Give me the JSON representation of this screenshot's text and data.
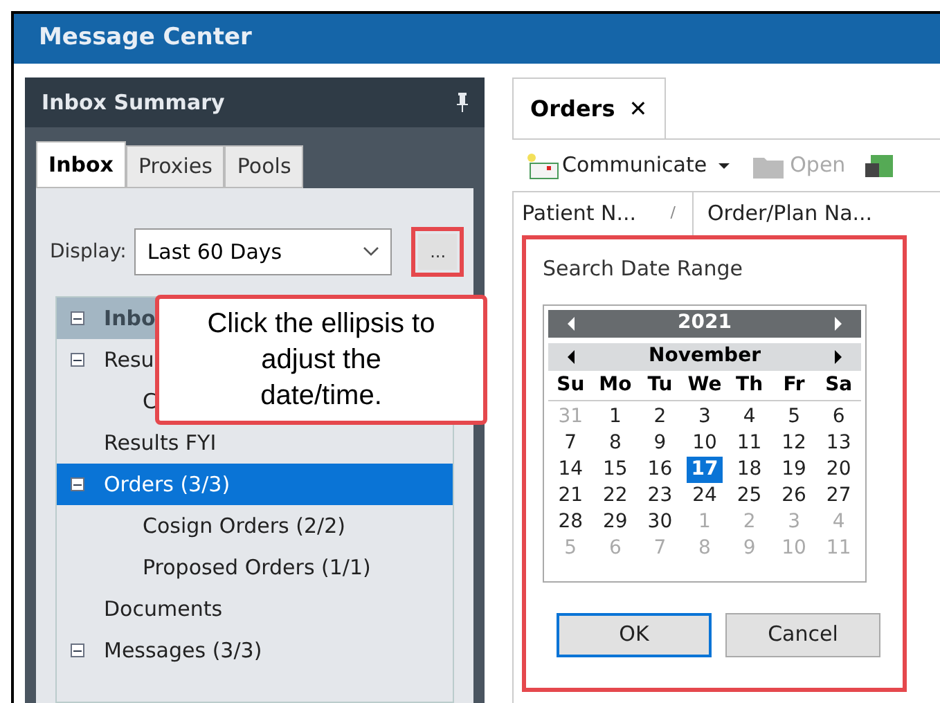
{
  "window": {
    "title": "Message Center"
  },
  "inbox_summary": {
    "title": "Inbox Summary",
    "tabs": [
      {
        "label": "Inbox",
        "selected": true
      },
      {
        "label": "Proxies",
        "selected": false
      },
      {
        "label": "Pools",
        "selected": false
      }
    ],
    "display": {
      "label": "Display:",
      "value": "Last 60 Days",
      "ellipsis": "..."
    },
    "tree": [
      {
        "label": "Inbo",
        "header": true,
        "expanded": true,
        "selected": false,
        "children": [
          {
            "label": "Resu",
            "expanded": true,
            "selected": false,
            "children": [
              {
                "label": "C",
                "selected": false
              }
            ]
          },
          {
            "label": "Results FYI",
            "selected": false
          },
          {
            "label": "Orders (3/3)",
            "expanded": true,
            "selected": true,
            "children": [
              {
                "label": "Cosign Orders (2/2)",
                "selected": false
              },
              {
                "label": "Proposed Orders (1/1)",
                "selected": false
              }
            ]
          },
          {
            "label": "Documents",
            "selected": false
          },
          {
            "label": "Messages (3/3)",
            "expanded": true,
            "selected": false
          }
        ]
      }
    ]
  },
  "callout": {
    "text": "Click the ellipsis to adjust the date/time."
  },
  "orders": {
    "tab": {
      "label": "Orders",
      "close": "✕"
    },
    "toolbar": [
      {
        "label": "Communicate",
        "kind": "menu",
        "disabled": false
      },
      {
        "label": "Open",
        "kind": "button",
        "disabled": true
      }
    ],
    "columns": [
      "Patient N...",
      "Order/Plan Na..."
    ],
    "sort_mark": "/"
  },
  "date_range": {
    "title": "Search Date Range",
    "year": "2021",
    "month": "November",
    "weekdays": [
      "Su",
      "Mo",
      "Tu",
      "We",
      "Th",
      "Fr",
      "Sa"
    ],
    "days": [
      {
        "label": "31",
        "muted": true,
        "selected": false
      },
      {
        "label": "1",
        "muted": false,
        "selected": false
      },
      {
        "label": "2",
        "muted": false,
        "selected": false
      },
      {
        "label": "3",
        "muted": false,
        "selected": false
      },
      {
        "label": "4",
        "muted": false,
        "selected": false
      },
      {
        "label": "5",
        "muted": false,
        "selected": false
      },
      {
        "label": "6",
        "muted": false,
        "selected": false
      },
      {
        "label": "7",
        "muted": false,
        "selected": false
      },
      {
        "label": "8",
        "muted": false,
        "selected": false
      },
      {
        "label": "9",
        "muted": false,
        "selected": false
      },
      {
        "label": "10",
        "muted": false,
        "selected": false
      },
      {
        "label": "11",
        "muted": false,
        "selected": false
      },
      {
        "label": "12",
        "muted": false,
        "selected": false
      },
      {
        "label": "13",
        "muted": false,
        "selected": false
      },
      {
        "label": "14",
        "muted": false,
        "selected": false
      },
      {
        "label": "15",
        "muted": false,
        "selected": false
      },
      {
        "label": "16",
        "muted": false,
        "selected": false
      },
      {
        "label": "17",
        "muted": false,
        "selected": true
      },
      {
        "label": "18",
        "muted": false,
        "selected": false
      },
      {
        "label": "19",
        "muted": false,
        "selected": false
      },
      {
        "label": "20",
        "muted": false,
        "selected": false
      },
      {
        "label": "21",
        "muted": false,
        "selected": false
      },
      {
        "label": "22",
        "muted": false,
        "selected": false
      },
      {
        "label": "23",
        "muted": false,
        "selected": false
      },
      {
        "label": "24",
        "muted": false,
        "selected": false
      },
      {
        "label": "25",
        "muted": false,
        "selected": false
      },
      {
        "label": "26",
        "muted": false,
        "selected": false
      },
      {
        "label": "27",
        "muted": false,
        "selected": false
      },
      {
        "label": "28",
        "muted": false,
        "selected": false
      },
      {
        "label": "29",
        "muted": false,
        "selected": false
      },
      {
        "label": "30",
        "muted": false,
        "selected": false
      },
      {
        "label": "1",
        "muted": true,
        "selected": false
      },
      {
        "label": "2",
        "muted": true,
        "selected": false
      },
      {
        "label": "3",
        "muted": true,
        "selected": false
      },
      {
        "label": "4",
        "muted": true,
        "selected": false
      },
      {
        "label": "5",
        "muted": true,
        "selected": false
      },
      {
        "label": "6",
        "muted": true,
        "selected": false
      },
      {
        "label": "7",
        "muted": true,
        "selected": false
      },
      {
        "label": "8",
        "muted": true,
        "selected": false
      },
      {
        "label": "9",
        "muted": true,
        "selected": false
      },
      {
        "label": "10",
        "muted": true,
        "selected": false
      },
      {
        "label": "11",
        "muted": true,
        "selected": false
      }
    ],
    "buttons": [
      {
        "label": "OK",
        "kind": "default"
      },
      {
        "label": "Cancel",
        "kind": "normal"
      }
    ]
  }
}
